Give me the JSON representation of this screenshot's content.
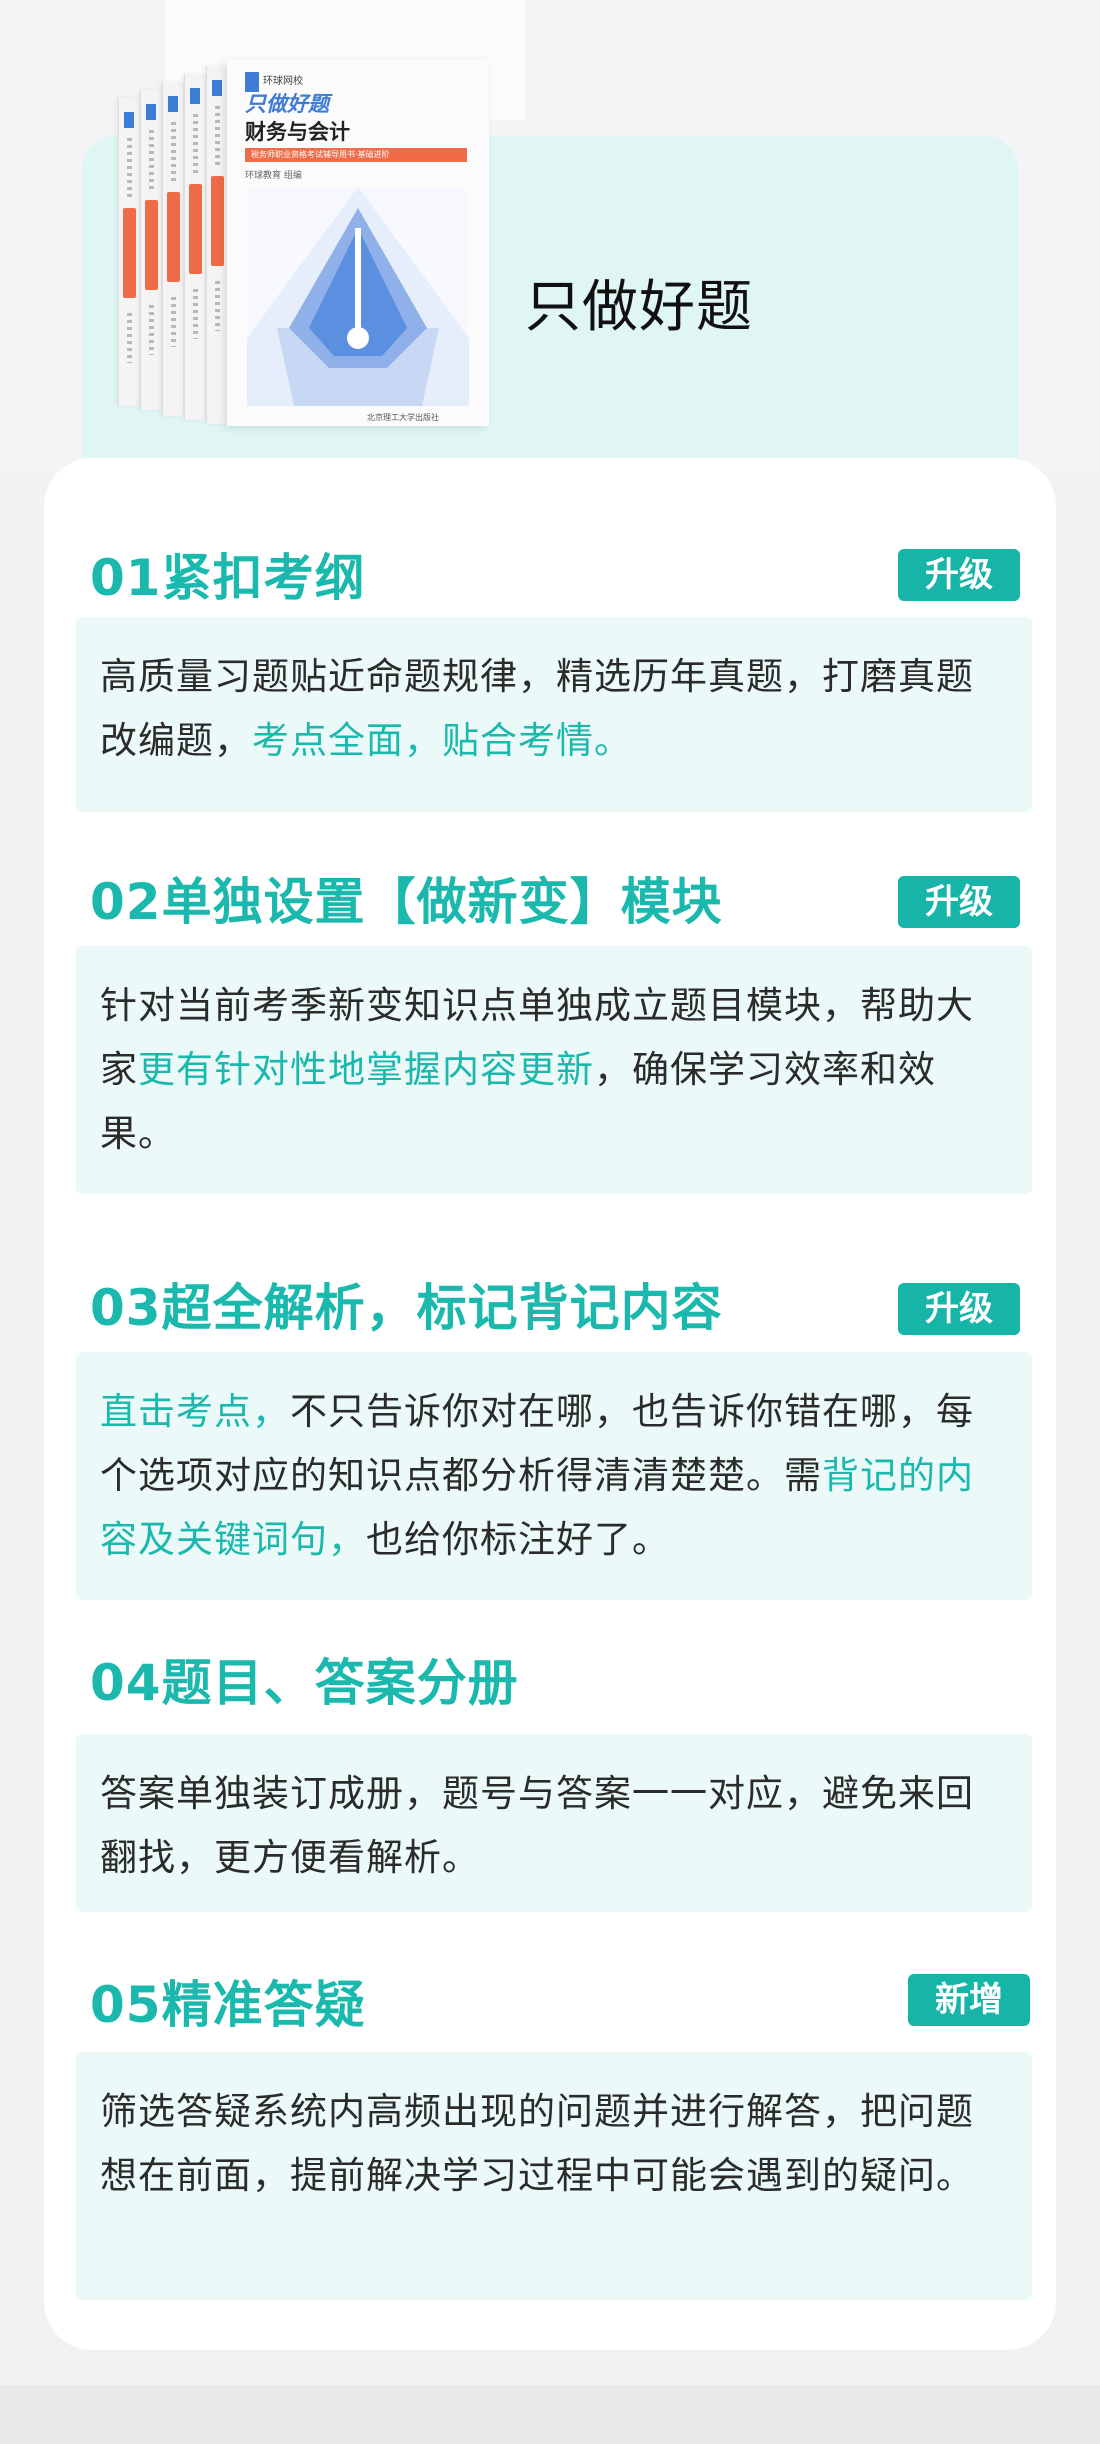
{
  "hero": {
    "title": "只做好题",
    "book": {
      "brand": "环球网校",
      "series": "只做好题",
      "subject": "财务与会计",
      "band": "税务师职业资格考试辅导用书·基础进阶",
      "author": "环球教育 组编",
      "publisher": "北京理工大学出版社"
    }
  },
  "sections": [
    {
      "title": "01紧扣考纲",
      "badge": "升级",
      "text_before": "高质量习题贴近命题规律，精选历年真题，打磨真题改编题，",
      "highlight": "考点全面，贴合考情。",
      "text_after": ""
    },
    {
      "title": "02单独设置【做新变】模块",
      "badge": "升级",
      "text_before": "针对当前考季新变知识点单独成立题目模块，帮助大家",
      "highlight": "更有针对性地掌握内容更新",
      "text_after": "，确保学习效率和效果。"
    },
    {
      "title": "03超全解析，标记背记内容",
      "badge": "升级",
      "hl_a": "直击考点，",
      "text_a": "不只告诉你对在哪，也告诉你错在哪，每个选项对应的知识点都分析得清清楚楚。需",
      "hl_b": "背记的内容及关键词句，",
      "text_b": "也给你标注好了。"
    },
    {
      "title": "04题目、答案分册",
      "text": "答案单独装订成册，题号与答案一一对应，避免来回翻找，更方便看解析。"
    },
    {
      "title": "05精准答疑",
      "badge": "新增",
      "text": "筛选答疑系统内高频出现的问题并进行解答，把问题想在前面，提前解决学习过程中可能会遇到的疑问。"
    }
  ]
}
